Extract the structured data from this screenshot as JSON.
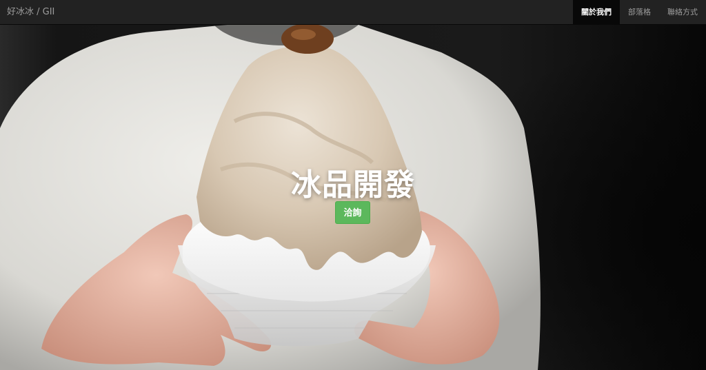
{
  "navbar": {
    "brand": "好冰冰 / GII",
    "items": [
      {
        "label": "關於我們",
        "active": true
      },
      {
        "label": "部落格",
        "active": false
      },
      {
        "label": "聯絡方式",
        "active": false
      }
    ]
  },
  "hero": {
    "title": "冰品開發",
    "button_label": "洽詢",
    "image": "shaved-ice-dessert-held-in-hands"
  },
  "colors": {
    "navbar_bg": "#222222",
    "nav_active_bg": "#080808",
    "button_green": "#5cb85c"
  }
}
